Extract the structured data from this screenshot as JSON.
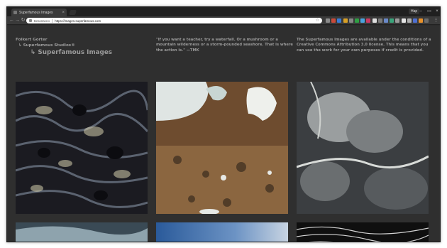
{
  "browser": {
    "tab_title": "Superfamous Images",
    "tab_close": "×",
    "profile_name": "Hap",
    "window_controls": [
      "–",
      "▭",
      "×"
    ],
    "nav": {
      "back": "←",
      "forward": "→",
      "reload": "↻"
    },
    "omnibox": {
      "security_label": "Безопасно",
      "url": "https://images.superfamous.com",
      "bookmark_icon": "star-icon"
    },
    "menu_icon": "⋮",
    "extension_colors": [
      "#8a8a8a",
      "#c94a3a",
      "#3a7bd5",
      "#d8a026",
      "#888888",
      "#2f9e44",
      "#4aa3df",
      "#c93a63",
      "#e0e0e0",
      "#7a7a7a",
      "#6a88c8",
      "#3aa37a",
      "#9a9a9a",
      "#e6e6e6",
      "#b0b0b0",
      "#4f6fd0",
      "#e8912a",
      "#6a6a6a"
    ]
  },
  "header": {
    "author": "Folkert Gorter",
    "studio": "↳ Superfamous Studios®",
    "site": "↳ Superfamous Images",
    "quote": "\"If you want a teacher, try a waterfall. Or a mushroom or a mountain wilderness or a storm-pounded seashore. That is where the action is.\" —TMK",
    "license": "The Superfamous Images are available under the conditions of a Creative Commons Attribution 3.0 license. This means that you can use the work for your own purposes if credit is provided."
  },
  "gallery": [
    {
      "name": "ice-crystal-closeup",
      "palette": [
        "#1c1c22",
        "#5b6470",
        "#c9c2a4"
      ]
    },
    {
      "name": "aerial-lake-snow",
      "palette": [
        "#6b4a2e",
        "#a98660",
        "#e4e7e3"
      ]
    },
    {
      "name": "rock-texture-closeup",
      "palette": [
        "#3a3d40",
        "#7d8183",
        "#c9ccc8"
      ]
    },
    {
      "name": "blue-ice-closeup",
      "palette": [
        "#3a4a55",
        "#8ea3ad",
        "#d0d8da"
      ]
    },
    {
      "name": "blue-sky-horizon",
      "palette": [
        "#2a5a9a",
        "#6c93c4",
        "#b8cbe0"
      ]
    },
    {
      "name": "dark-water-streaks",
      "palette": [
        "#0e0e0e",
        "#4a4a4a",
        "#d8d8d8"
      ]
    }
  ]
}
